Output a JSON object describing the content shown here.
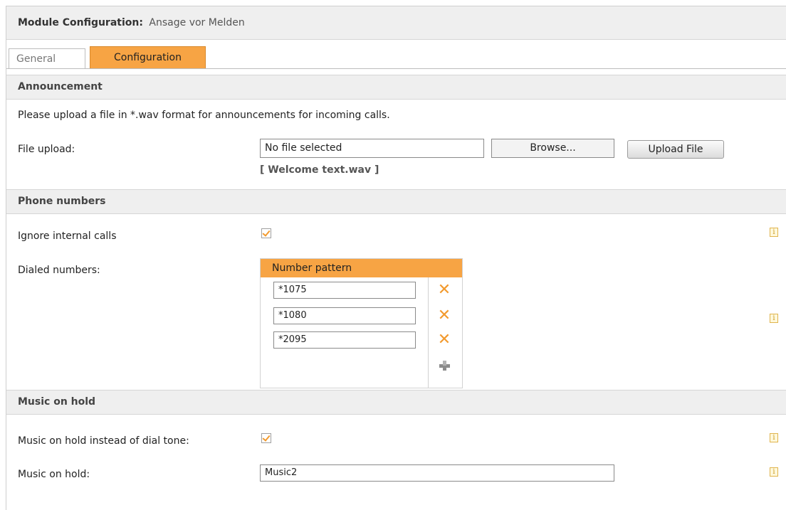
{
  "header": {
    "title": "Module Configuration:",
    "module_name": "Ansage vor Melden"
  },
  "tabs": [
    {
      "label": "General",
      "active": false
    },
    {
      "label": "Configuration",
      "active": true
    }
  ],
  "announcement": {
    "section_title": "Announcement",
    "description": "Please upload a file in *.wav format for announcements for incoming calls.",
    "file_upload_label": "File upload:",
    "file_input_value": "No file selected",
    "browse_label": "Browse...",
    "upload_label": "Upload File",
    "current_file": "[ Welcome text.wav ]"
  },
  "phone_numbers": {
    "section_title": "Phone numbers",
    "ignore_internal_label": "Ignore internal calls",
    "ignore_internal_checked": true,
    "dialed_numbers_label": "Dialed numbers:",
    "pattern_column_header": "Number pattern",
    "patterns": [
      "*1075",
      "*1080",
      "*2095"
    ]
  },
  "music_on_hold": {
    "section_title": "Music on hold",
    "instead_of_dial_tone_label": "Music on hold instead of dial tone:",
    "instead_of_dial_tone_checked": true,
    "music_label": "Music on hold:",
    "music_value": "Music2"
  },
  "icons": {
    "info": "info-icon",
    "delete": "delete-x-icon",
    "add": "plus-icon"
  },
  "colors": {
    "accent": "#f7a444",
    "section_bg": "#efefef",
    "info": "#c99a20"
  }
}
